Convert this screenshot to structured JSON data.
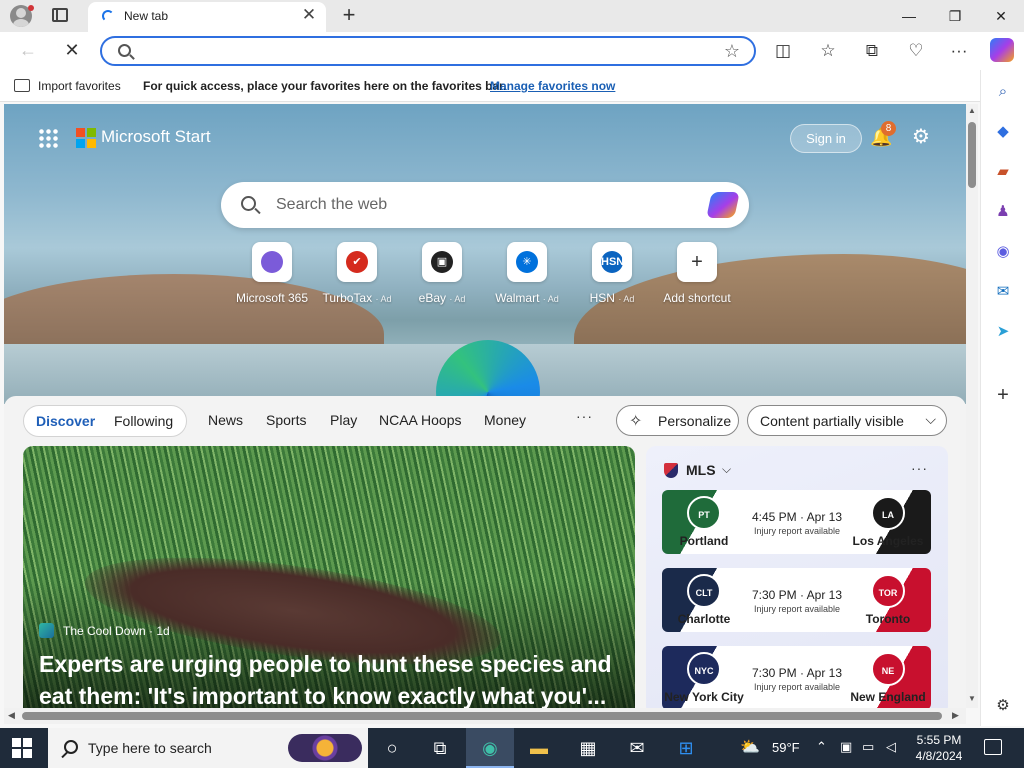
{
  "browser": {
    "tab_title": "New tab",
    "tab_close": "✕",
    "new_tab": "+",
    "window": {
      "minimize": "—",
      "restore": "❐",
      "close": "✕"
    }
  },
  "toolbar": {
    "back": "←",
    "stop": "✕",
    "address_value": "",
    "favorite_star": "☆",
    "split_screen": "◫",
    "favorites": "☆",
    "collections": "⧉",
    "browser_essentials": "♡",
    "more": "···"
  },
  "favorites_bar": {
    "import_label": "Import favorites",
    "message": "For quick access, place your favorites here on the favorites bar.",
    "manage_link": "Manage favorites now"
  },
  "msn": {
    "brand": "Microsoft Start",
    "sign_in": "Sign in",
    "notifications_count": "8",
    "bell_icon": "🔔",
    "settings_icon": "⚙",
    "search_placeholder": "Search the web",
    "logo_colors": [
      "#f25022",
      "#7fba00",
      "#00a4ef",
      "#ffb900"
    ]
  },
  "shortcuts": [
    {
      "name": "Microsoft 365",
      "ad": "",
      "glyph": "",
      "color": "#7b5bd9"
    },
    {
      "name": "TurboTax",
      "ad": "· Ad",
      "glyph": "✔",
      "color": "#d52b1e"
    },
    {
      "name": "eBay",
      "ad": "· Ad",
      "glyph": "▣",
      "color": "#222222"
    },
    {
      "name": "Walmart",
      "ad": "· Ad",
      "glyph": "✳",
      "color": "#0071dc"
    },
    {
      "name": "HSN",
      "ad": "· Ad",
      "glyph": "HSN",
      "color": "#0b64c0"
    },
    {
      "name": "Add shortcut",
      "ad": "",
      "glyph": "+",
      "color": "#ffffff"
    }
  ],
  "feed": {
    "tabs": [
      "Discover",
      "Following"
    ],
    "nav": [
      "News",
      "Sports",
      "Play",
      "NCAA Hoops",
      "Money"
    ],
    "more": "···",
    "personalize": "Personalize",
    "personalize_icon": "✧",
    "content_visibility": "Content partially visible",
    "content_chevron": "⌵"
  },
  "article": {
    "source": "The Cool Down · 1d",
    "headline": "Experts are urging people to hunt these species and eat them: 'It's important to know exactly what you'..."
  },
  "mls": {
    "title": "MLS",
    "chevron": "⌵",
    "more": "···",
    "games": [
      {
        "home": "Portland",
        "home_abbr": "PT",
        "home_color": "#1f6b3a",
        "away": "Los Angeles",
        "away_abbr": "LA",
        "away_color": "#1a1a1a",
        "time": "4:45 PM · Apr 13",
        "note": "Injury report available"
      },
      {
        "home": "Charlotte",
        "home_abbr": "CLT",
        "home_color": "#1a2a4a",
        "away": "Toronto",
        "away_abbr": "TOR",
        "away_color": "#c8102e",
        "time": "7:30 PM · Apr 13",
        "note": "Injury report available"
      },
      {
        "home": "New York City",
        "home_abbr": "NYC",
        "home_color": "#1d2a5c",
        "away": "New England",
        "away_abbr": "NE",
        "away_color": "#c8102e",
        "time": "7:30 PM · Apr 13",
        "note": "Injury report available"
      }
    ]
  },
  "sidebar": {
    "icons": [
      {
        "name": "search",
        "glyph": "⌕",
        "color": "#2b5fb3"
      },
      {
        "name": "shopping",
        "glyph": "◆",
        "color": "#2f6fe0"
      },
      {
        "name": "tools",
        "glyph": "▰",
        "color": "#c8522b"
      },
      {
        "name": "games",
        "glyph": "♟",
        "color": "#7b3fb0"
      },
      {
        "name": "microsoft-365",
        "glyph": "◉",
        "color": "#5b5ce0"
      },
      {
        "name": "outlook",
        "glyph": "✉",
        "color": "#0f6cbd"
      },
      {
        "name": "drop",
        "glyph": "➤",
        "color": "#2a9fd6"
      }
    ],
    "add": "+",
    "settings": "⚙"
  },
  "taskbar": {
    "search_placeholder": "Type here to search",
    "weather": "59°F",
    "weather_icon": "⛅",
    "time": "5:55 PM",
    "date": "4/8/2024"
  }
}
